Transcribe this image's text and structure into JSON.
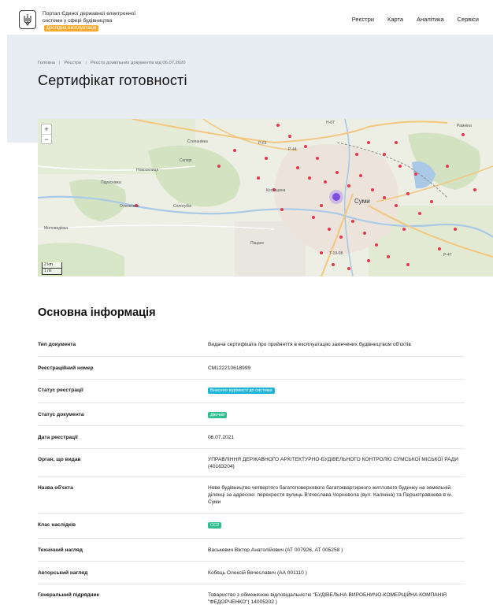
{
  "header": {
    "portal_text": "Портал Єдиної державної електронної системи у сфері будівництва",
    "beta_badge": "Дослідна експлуатація",
    "nav": [
      "Реєстри",
      "Карта",
      "Аналітика",
      "Сервіси"
    ]
  },
  "breadcrumb": [
    "Головна",
    "Реєстри",
    "Реєстр дозвільних документів від 06.07.2020"
  ],
  "page_title": "Сертифікат готовності",
  "map": {
    "zoom_in": "+",
    "zoom_out": "−",
    "scale_km": "2 km",
    "scale_mi": "1 mi",
    "labels": [
      "Степанівка",
      "Суми",
      "Косівщина",
      "Новоселиця",
      "Підліснівка",
      "Олексіївка",
      "Сологубів",
      "Миловидівка",
      "Склярі",
      "Рамніна",
      "Піщане",
      "H-07",
      "P-61",
      "P-44",
      "T-19-08",
      "P-47"
    ]
  },
  "section_title": "Основна інформація",
  "info_rows": [
    {
      "label": "Тип документа",
      "value": "Видача сертифіката про прийняття в експлуатацію закінчених будівництвом об'єктів"
    },
    {
      "label": "Реєстраційний номер",
      "value": "СМ122210618999"
    },
    {
      "label": "Статус реєстрації",
      "value": "Внесено відомості до системи",
      "tag_color": "#1fb4d6"
    },
    {
      "label": "Статус документа",
      "value": "Діючий",
      "tag_color": "#2fbf8f"
    },
    {
      "label": "Дата реєстрації",
      "value": "06.07.2021"
    },
    {
      "label": "Орган, що видав",
      "value": "УПРАВЛІННЯ ДЕРЖАВНОГО АРХІТЕКТУРНО-БУДІВЕЛЬНОГО КОНТРОЛЮ СУМСЬКОЇ МІСЬКОЇ РАДИ (40163204)"
    },
    {
      "label": "Назва об'єкта",
      "value": "Нове будівництво четвертого багатоповерхового багатоквартирного житлового будинку на земельній ділянці за адресою: перехрестя вулиць В'ячеслава Чорновола (вул. Калініна) та Першотравнева в м. Суми"
    },
    {
      "label": "Клас наслідків",
      "value": "СС2",
      "tag_color": "#2fbf8f"
    },
    {
      "label": "Технічний нагляд",
      "value": "Васькевич Віктор Анатолійович (АТ 007926, АТ 005258 )"
    },
    {
      "label": "Авторський нагляд",
      "value": "Кобець Олексій Вячеславич (АА 001110 )"
    },
    {
      "label": "Генеральний підрядник",
      "value": "Товариство з обмеженою відповідальністю \"БУДІВЕЛЬНА ВИРОБНИЧО-КОМЕРЦІЙНА КОМПАНІЯ \"ФЕДОРЧЕНКО\"( 14005202 )"
    }
  ]
}
